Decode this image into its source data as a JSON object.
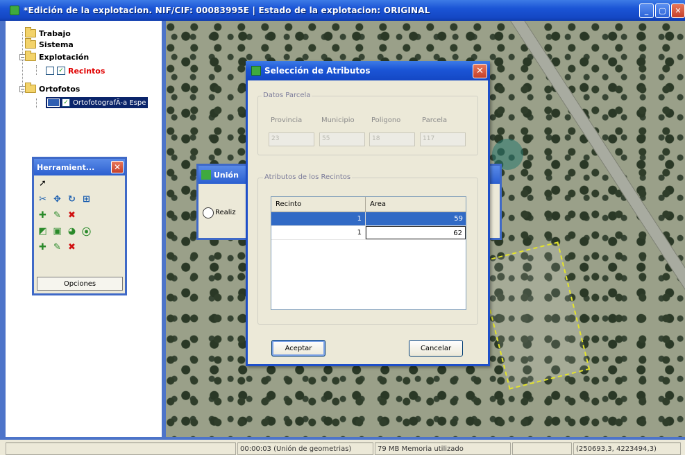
{
  "window": {
    "title": "*Edición de la explotacion. NIF/CIF: 00083995E | Estado de la explotacion: ORIGINAL",
    "minimize": "_",
    "maximize": "▢",
    "close": "✕"
  },
  "tree": {
    "nodes": [
      {
        "label": "Trabajo"
      },
      {
        "label": "Sistema"
      },
      {
        "label": "Explotación"
      },
      {
        "label": "Recintos"
      },
      {
        "label": "Ortofotos"
      },
      {
        "label": "OrtofotografÃ-a Espe"
      }
    ],
    "expander_minus": "−"
  },
  "toolbox": {
    "title": "Herramient...",
    "close": "✕",
    "options_label": "Opciones"
  },
  "background_dialog": {
    "title": "Unión",
    "text": "Realiz"
  },
  "dialog": {
    "title": "Selección de Atributos",
    "close": "✕",
    "parcel_group": "Datos Parcela",
    "fields": [
      {
        "label": "Provincia",
        "value": "23"
      },
      {
        "label": "Municipio",
        "value": "55"
      },
      {
        "label": "Poligono",
        "value": "18"
      },
      {
        "label": "Parcela",
        "value": "117"
      }
    ],
    "attributes_group": "Atributos de los Recintos",
    "grid_headers": [
      "Recinto",
      "Area"
    ],
    "grid_rows": [
      {
        "recinto": "1",
        "area": "59",
        "selected": true
      },
      {
        "recinto": "1",
        "area": "62",
        "selected": false
      }
    ],
    "accept_label": "Aceptar",
    "cancel_label": "Cancelar"
  },
  "status": {
    "time": "00:00:03 (Unión de geometrias)",
    "memory": "79 MB Memoria utilizado",
    "coords": "(250693,3, 4223494,3)"
  }
}
